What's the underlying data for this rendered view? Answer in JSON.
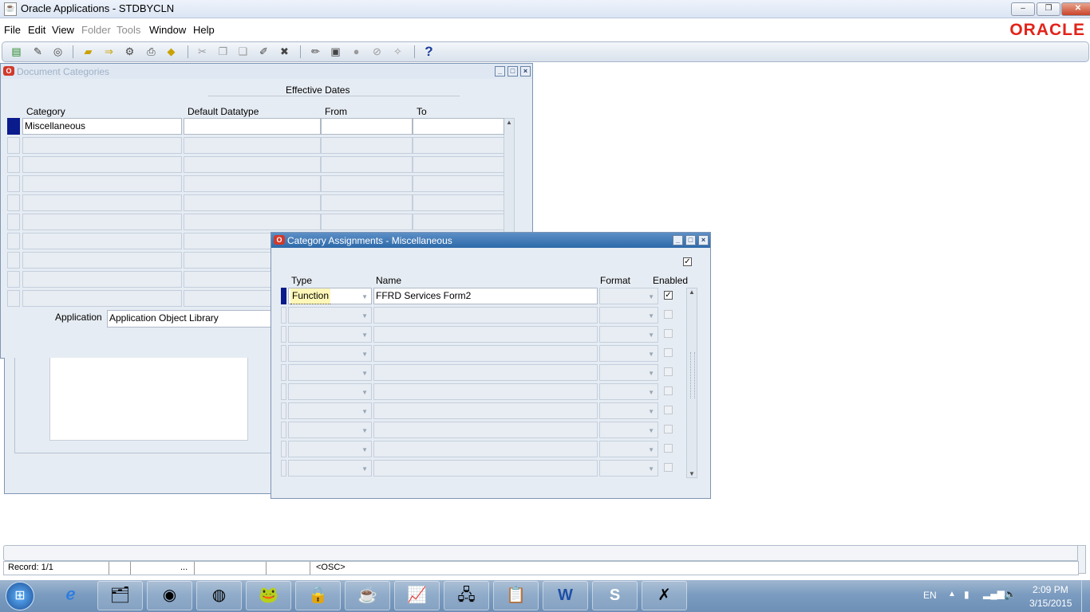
{
  "window": {
    "title": "Oracle Applications - STDBYCLN",
    "controls": [
      "–",
      "❐",
      "✕"
    ]
  },
  "menu": [
    {
      "label": "File",
      "enabled": true
    },
    {
      "label": "Edit",
      "enabled": true
    },
    {
      "label": "View",
      "enabled": true
    },
    {
      "label": "Folder",
      "enabled": false
    },
    {
      "label": "Tools",
      "enabled": false
    },
    {
      "label": "Window",
      "enabled": true
    },
    {
      "label": "Help",
      "enabled": true
    }
  ],
  "brand": {
    "logo": "ORACLE",
    "color": "#e2231a"
  },
  "toolbar_icons": [
    "new-record-icon",
    "find-icon",
    "navigator-icon",
    "save-icon",
    "next-step-icon",
    "switch-responsibility-icon",
    "print-icon",
    "close-form-icon",
    "cut-icon",
    "copy-icon",
    "paste-icon",
    "clear-record-icon",
    "delete-record-icon",
    "edit-field-icon",
    "zoom-icon",
    "translations-icon",
    "attachments-icon",
    "folder-tools-icon",
    "help-icon"
  ],
  "doc_categories": {
    "title": "Document Categories",
    "group_label": "Effective Dates",
    "headers": {
      "category": "Category",
      "datatype": "Default Datatype",
      "from": "From",
      "to": "To"
    },
    "rows": [
      {
        "category": "Miscellaneous",
        "datatype": "",
        "from": "",
        "to": ""
      },
      {
        "category": "",
        "datatype": "",
        "from": "",
        "to": ""
      },
      {
        "category": "",
        "datatype": "",
        "from": "",
        "to": ""
      },
      {
        "category": "",
        "datatype": "",
        "from": "",
        "to": ""
      },
      {
        "category": "",
        "datatype": "",
        "from": "",
        "to": ""
      },
      {
        "category": "",
        "datatype": "",
        "from": "",
        "to": ""
      },
      {
        "category": "",
        "datatype": "",
        "from": "",
        "to": ""
      },
      {
        "category": "",
        "datatype": "",
        "from": "",
        "to": ""
      },
      {
        "category": "",
        "datatype": "",
        "from": "",
        "to": ""
      },
      {
        "category": "",
        "datatype": "",
        "from": "",
        "to": ""
      }
    ],
    "application_label": "Application",
    "application_value": "Application Object Library"
  },
  "assignments": {
    "title": "Category Assignments - Miscellaneous",
    "headers": {
      "type": "Type",
      "name": "Name",
      "format": "Format",
      "enabled": "Enabled"
    },
    "rows": [
      {
        "type": "Function",
        "name": "FFRD Services Form2",
        "format": "",
        "enabled": true
      },
      {
        "type": "",
        "name": "",
        "format": "",
        "enabled": false
      },
      {
        "type": "",
        "name": "",
        "format": "",
        "enabled": false
      },
      {
        "type": "",
        "name": "",
        "format": "",
        "enabled": false
      },
      {
        "type": "",
        "name": "",
        "format": "",
        "enabled": false
      },
      {
        "type": "",
        "name": "",
        "format": "",
        "enabled": false
      },
      {
        "type": "",
        "name": "",
        "format": "",
        "enabled": false
      },
      {
        "type": "",
        "name": "",
        "format": "",
        "enabled": false
      },
      {
        "type": "",
        "name": "",
        "format": "",
        "enabled": false
      },
      {
        "type": "",
        "name": "",
        "format": "",
        "enabled": false
      }
    ]
  },
  "status": {
    "record": "Record: 1/1",
    "ellipsis": "...",
    "mode": "<OSC>"
  },
  "taskbar": {
    "apps": [
      "ie-icon",
      "file-explorer-icon",
      "firefox-icon",
      "chrome-icon",
      "toad-icon",
      "remote-access-icon",
      "java-icon",
      "chart-editor-icon",
      "network-icon",
      "presentation-icon",
      "word-icon",
      "skype-icon",
      "app-icon"
    ],
    "lang": "EN",
    "time": "2:09 PM",
    "date": "3/15/2015"
  }
}
